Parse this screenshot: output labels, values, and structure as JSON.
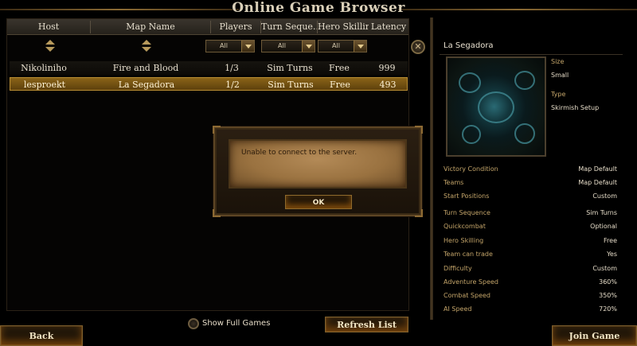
{
  "window": {
    "title": "Online Game Browser"
  },
  "columns": [
    {
      "label": "Host"
    },
    {
      "label": "Map Name"
    },
    {
      "label": "Players"
    },
    {
      "label": "Turn Seque..."
    },
    {
      "label": "Hero Skilling"
    },
    {
      "label": "Latency"
    }
  ],
  "filters": {
    "players": "All",
    "turn_sequence": "All",
    "hero_skilling": "All"
  },
  "games": [
    {
      "host": "Nikoliniho",
      "map": "Fire and Blood",
      "players": "1/3",
      "turn": "Sim Turns",
      "skilling": "Free",
      "latency": "999"
    },
    {
      "host": "lesproekt",
      "map": "La Segadora",
      "players": "1/2",
      "turn": "Sim Turns",
      "skilling": "Free",
      "latency": "493"
    }
  ],
  "details": {
    "map_name": "La Segadora",
    "size_label": "Size",
    "size_value": "Small",
    "type_label": "Type",
    "type_value": "Skirmish Setup",
    "properties": [
      {
        "k": "Victory Condition",
        "v": "Map Default"
      },
      {
        "k": "Teams",
        "v": "Map Default"
      },
      {
        "k": "Start Positions",
        "v": "Custom"
      },
      {
        "k": "Turn Sequence",
        "v": "Sim Turns"
      },
      {
        "k": "Quickcombat",
        "v": "Optional"
      },
      {
        "k": "Hero Skilling",
        "v": "Free"
      },
      {
        "k": "Team can trade",
        "v": "Yes"
      },
      {
        "k": "Difficulty",
        "v": "Custom"
      },
      {
        "k": "Adventure Speed",
        "v": "360%"
      },
      {
        "k": "Combat Speed",
        "v": "350%"
      },
      {
        "k": "AI Speed",
        "v": "720%"
      }
    ]
  },
  "footer": {
    "show_full_games": "Show Full Games",
    "refresh": "Refresh List",
    "back": "Back",
    "join": "Join Game"
  },
  "dialog": {
    "message": "Unable to connect to the server.",
    "ok": "OK"
  }
}
